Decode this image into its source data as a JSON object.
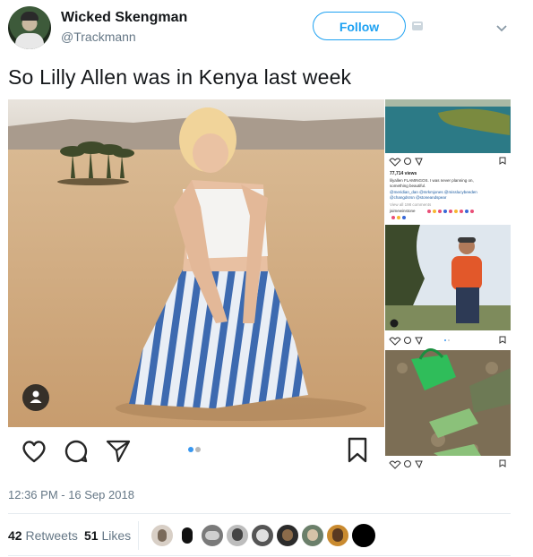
{
  "header": {
    "display_name": "Wicked Skengman",
    "handle": "@Trackmann",
    "follow_label": "Follow"
  },
  "tweet": {
    "text": "So Lilly Allen was in Kenya last week",
    "timestamp": "12:36 PM - 16 Sep 2018"
  },
  "stats": {
    "retweets_count": "42",
    "retweets_label": "Retweets",
    "likes_count": "51",
    "likes_label": "Likes"
  },
  "instagram_embed": {
    "views": "77,714 views",
    "caption": "lilyallen FLAMINGOS. I was never planning on, something beautiful.",
    "mentions": "@meridian_dan @mrkmjones @misslucybeeden @changdsrsn @stoneandspear",
    "view_comments": "View all 198 comments",
    "commenter": "jaimewinstone",
    "carousel_dots": 2,
    "carousel_active": 1
  },
  "colors": {
    "accent": "#1da1f2",
    "text": "#14171a",
    "secondary": "#657786",
    "divider": "#e6ecf0"
  },
  "icons": [
    "heart-icon",
    "comment-icon",
    "send-icon",
    "bookmark-icon",
    "user-tag-icon",
    "chevron-down-icon",
    "card-icon"
  ]
}
